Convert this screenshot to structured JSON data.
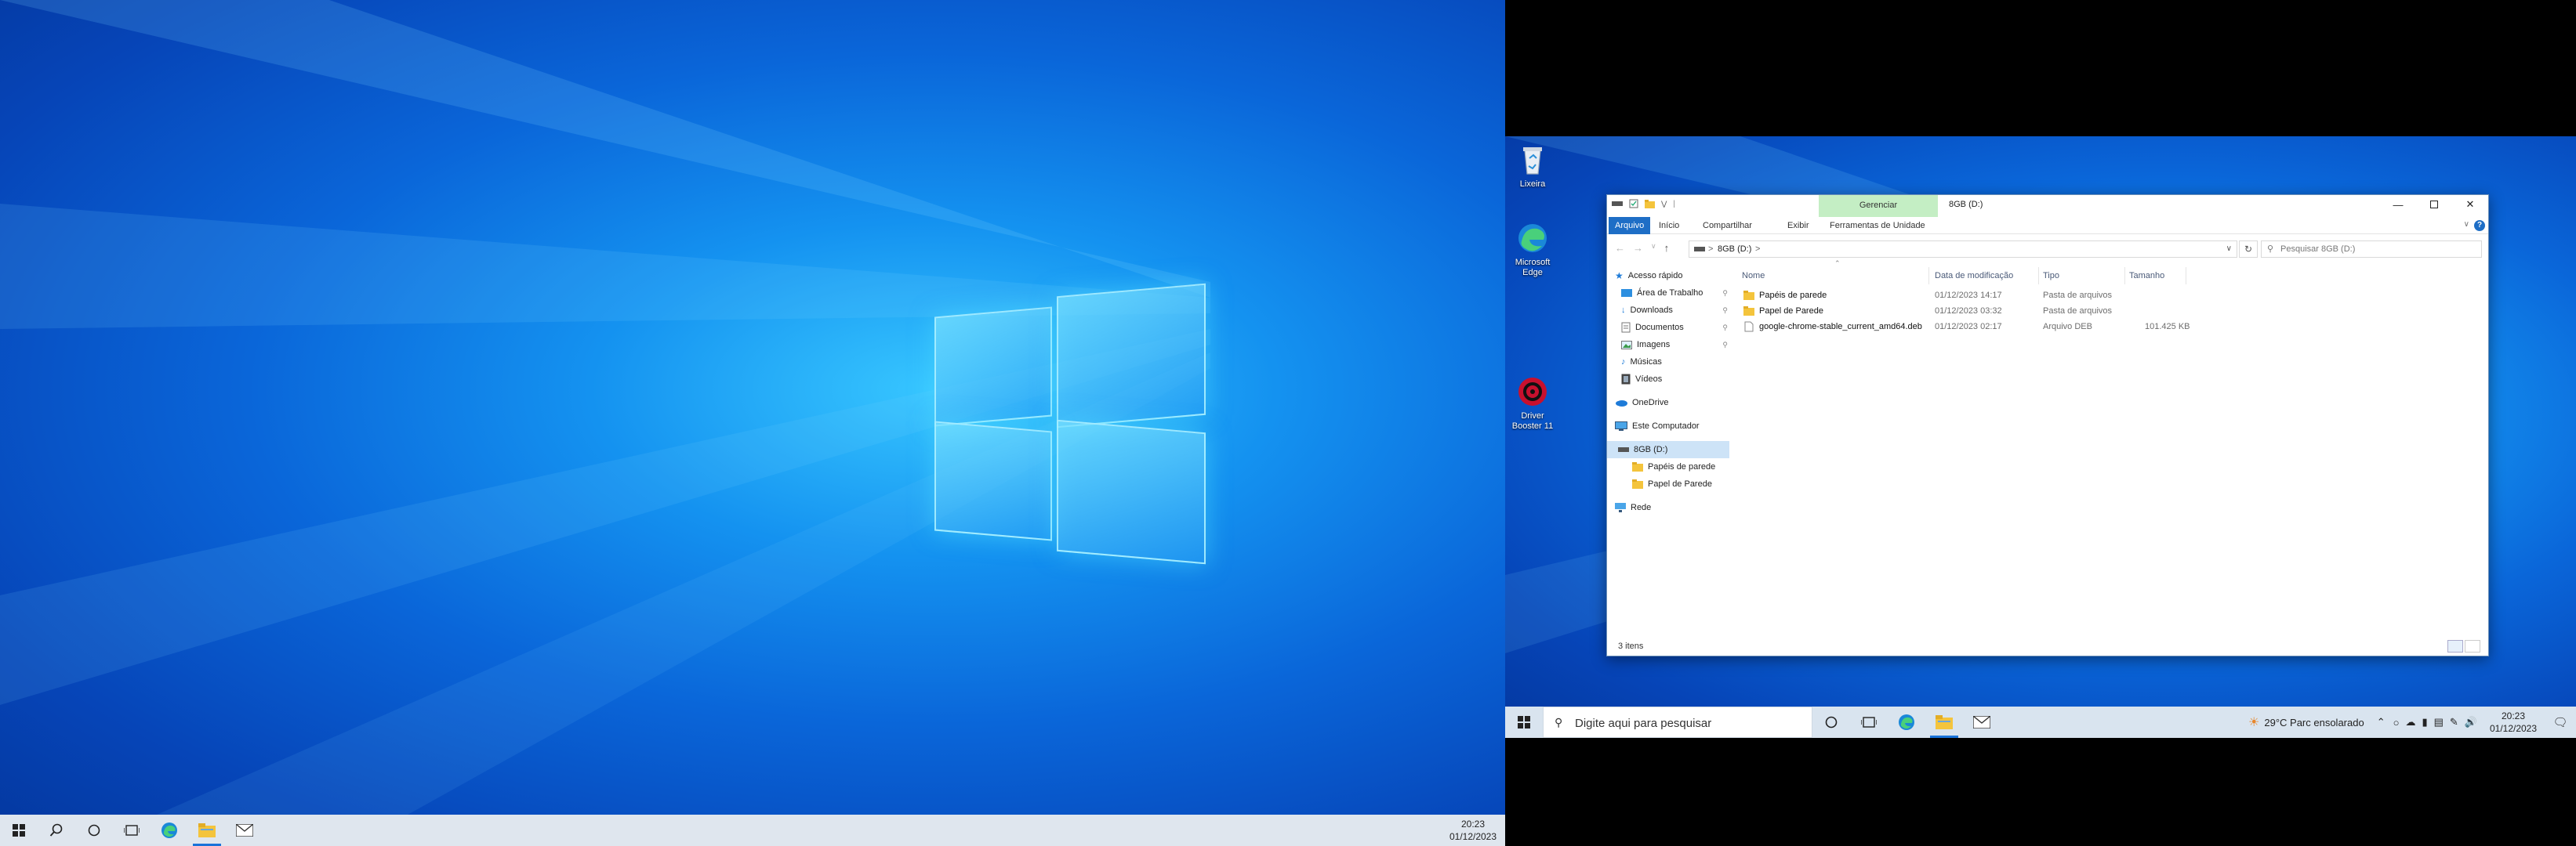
{
  "left_screen": {
    "taskbar": {
      "time": "20:23",
      "date": "01/12/2023",
      "icons": [
        "windows-start-icon",
        "search-icon",
        "cortana-icon",
        "task-view-icon",
        "edge-icon",
        "file-explorer-icon",
        "mail-icon"
      ]
    }
  },
  "right_screen": {
    "desktop_icons": [
      {
        "label": "Lixeira",
        "icon": "recycle-bin-icon"
      },
      {
        "label": "Microsoft Edge",
        "icon": "edge-icon"
      },
      {
        "label": "Driver Booster 11",
        "icon": "driver-booster-icon"
      }
    ],
    "explorer": {
      "title": "8GB (D:)",
      "contextual_tab": "Gerenciar",
      "ribbon_tabs": [
        "Arquivo",
        "Início",
        "Compartilhar",
        "Exibir",
        "Ferramentas de Unidade"
      ],
      "address": {
        "drive": "8GB (D:)",
        "sep": ">"
      },
      "search_placeholder": "Pesquisar 8GB (D:)",
      "nav": {
        "quick_access": "Acesso rápido",
        "desktop": "Área de Trabalho",
        "downloads": "Downloads",
        "documents": "Documentos",
        "images": "Imagens",
        "music": "Músicas",
        "videos": "Vídeos",
        "onedrive": "OneDrive",
        "this_pc": "Este Computador",
        "drive": "8GB (D:)",
        "sub1": "Papéis de parede",
        "sub2": "Papel de Parede",
        "network": "Rede"
      },
      "columns": {
        "name": "Nome",
        "date": "Data de modificação",
        "type": "Tipo",
        "size": "Tamanho"
      },
      "files": [
        {
          "name": "Papéis de parede",
          "date": "01/12/2023 14:17",
          "type": "Pasta de arquivos",
          "size": ""
        },
        {
          "name": "Papel de Parede",
          "date": "01/12/2023 03:32",
          "type": "Pasta de arquivos",
          "size": ""
        },
        {
          "name": "google-chrome-stable_current_amd64.deb",
          "date": "01/12/2023 02:17",
          "type": "Arquivo DEB",
          "size": "101.425 KB"
        }
      ],
      "status": "3 itens"
    },
    "taskbar": {
      "search_placeholder": "Digite aqui para pesquisar",
      "weather": "29°C  Parc ensolarado",
      "time": "20:23",
      "date": "01/12/2023"
    }
  }
}
